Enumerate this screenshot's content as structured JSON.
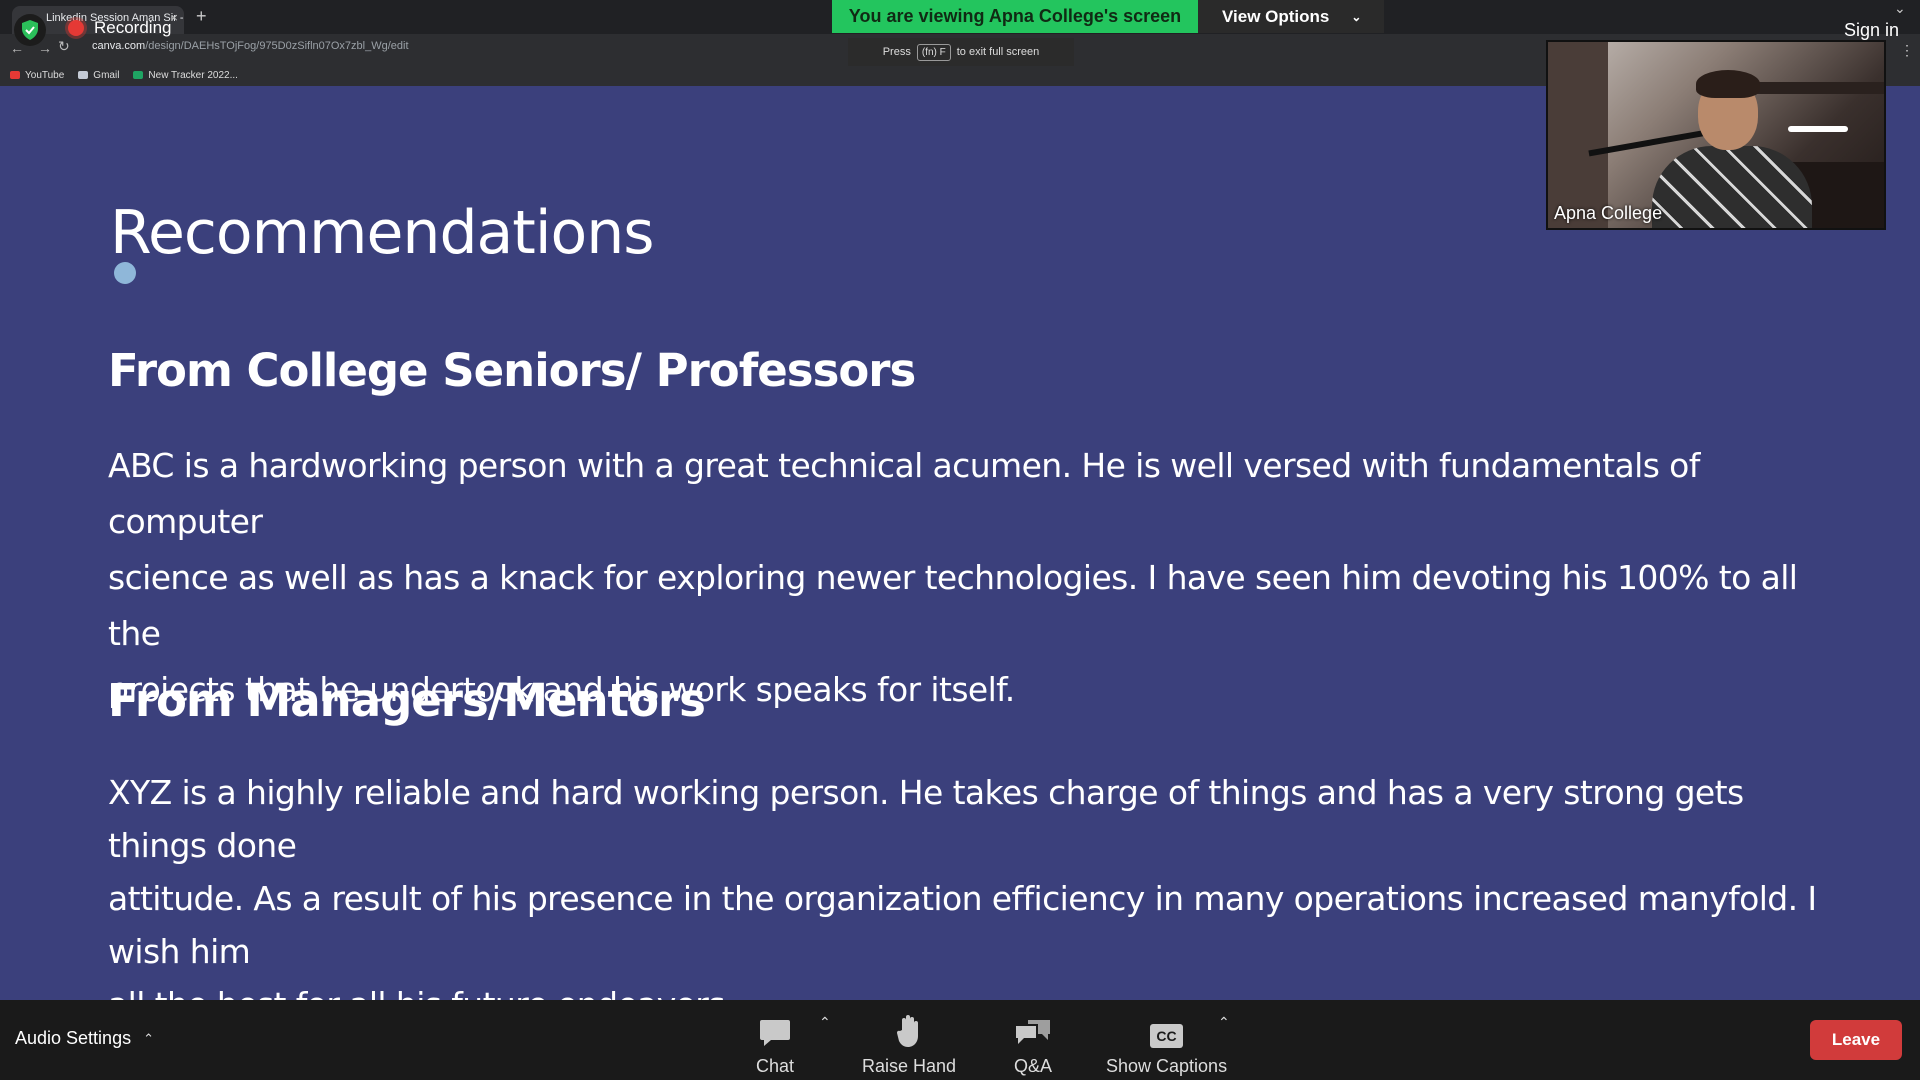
{
  "browser": {
    "tab_title": "Linkedin Session Aman Sir - F",
    "tab_close": "×",
    "new_tab": "+",
    "recording_label": "Recording",
    "url_host": "canva.com",
    "url_path": "/design/DAEHsTOjFog/975D0zSifln07Ox7zbl_Wg/edit",
    "bookmarks": [
      "YouTube",
      "Gmail",
      "New Tracker 2022..."
    ],
    "sign_in": "Sign in"
  },
  "zoom_banner": {
    "viewing_text": "You are viewing Apna College's screen",
    "view_options_label": "View Options",
    "hint_press": "Press",
    "hint_key": "(fn) F",
    "hint_rest": "to exit full screen"
  },
  "slide": {
    "title": "Recommendations",
    "section1_heading": "From College Seniors/ Professors",
    "section1_lines": [
      "ABC is a hardworking person with a great technical acumen. He is well versed with fundamentals of computer",
      "science as well as has a knack for exploring newer technologies. I have seen him devoting his 100% to all the",
      "projects that he undertook and his work speaks for itself."
    ],
    "section2_heading": "From Managers/Mentors",
    "section2_lines": [
      "XYZ is a highly reliable and hard working person. He takes charge of things and has a very strong gets things done",
      "attitude. As a result of his presence in the organization efficiency in many operations increased manyfold. I wish him",
      "all the best for all his future endeavors."
    ]
  },
  "video_tile": {
    "participant_name": "Apna College"
  },
  "toolbar": {
    "audio_settings": "Audio Settings",
    "chat": "Chat",
    "raise_hand": "Raise Hand",
    "qa": "Q&A",
    "show_captions": "Show Captions",
    "cc_text": "CC",
    "leave": "Leave"
  },
  "colors": {
    "slide_bg": "#3b407c",
    "banner_green": "#23c55e",
    "leave_red": "#d13b3b",
    "toolbar_bg": "#1a1a1a"
  }
}
